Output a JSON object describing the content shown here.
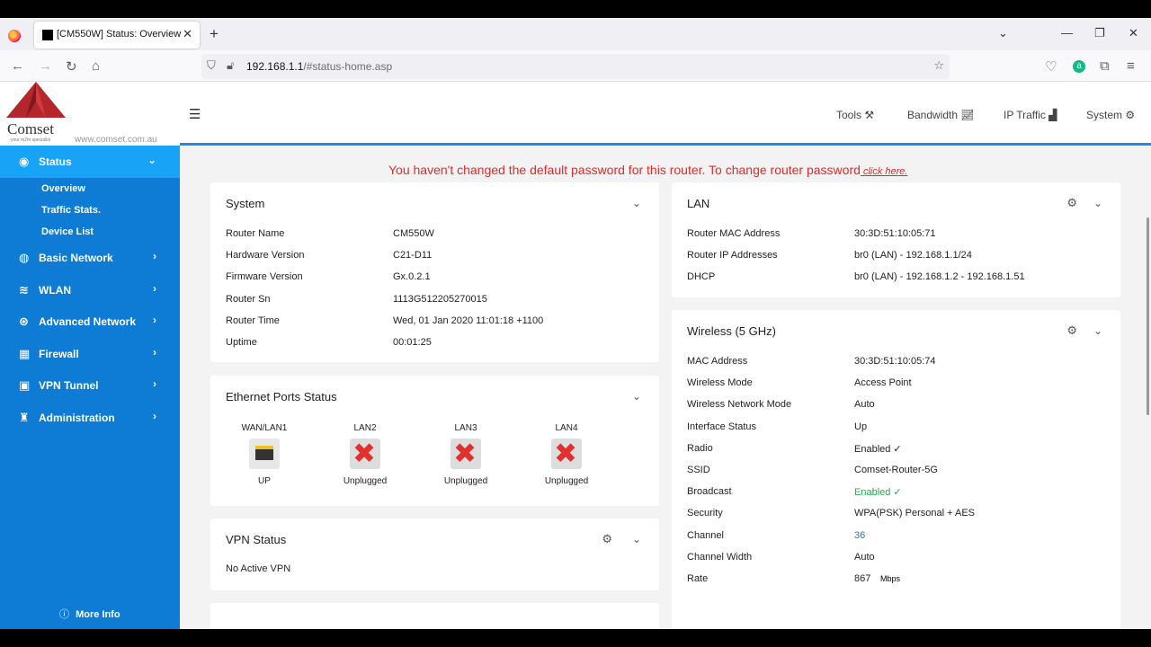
{
  "browser": {
    "tab_title": "[CM550W] Status: Overview",
    "url_host": "192.168.1.1",
    "url_path": "/#status-home.asp"
  },
  "brand": {
    "name": "Comset",
    "tagline": "your m2m specialist",
    "website": "www.comset.com.au",
    "logo_color": "#b3262b"
  },
  "topnav": {
    "tools": "Tools",
    "bandwidth": "Bandwidth",
    "ip_traffic": "IP Traffic",
    "system": "System"
  },
  "sidebar": {
    "status": "Status",
    "sub": [
      "Overview",
      "Traffic Stats.",
      "Device List"
    ],
    "items": [
      "Basic Network",
      "WLAN",
      "Advanced Network",
      "Firewall",
      "VPN Tunnel",
      "Administration"
    ],
    "more_info": "More Info"
  },
  "warning": {
    "text": "You haven't changed the default password for this router. To change router password",
    "link": " click here."
  },
  "system": {
    "title": "System",
    "rows": [
      {
        "label": "Router Name",
        "value": "CM550W"
      },
      {
        "label": "Hardware Version",
        "value": "C21-D11"
      },
      {
        "label": "Firmware Version",
        "value": "Gx.0.2.1"
      },
      {
        "label": "Router Sn",
        "value": "1113G512205270015"
      },
      {
        "label": "Router Time",
        "value": "Wed, 01 Jan 2020 11:01:18 +1100"
      },
      {
        "label": "Uptime",
        "value": "00:01:25"
      }
    ]
  },
  "ethernet": {
    "title": "Ethernet Ports Status",
    "ports": [
      {
        "name": "WAN/LAN1",
        "status": "UP"
      },
      {
        "name": "LAN2",
        "status": "Unplugged"
      },
      {
        "name": "LAN3",
        "status": "Unplugged"
      },
      {
        "name": "LAN4",
        "status": "Unplugged"
      }
    ]
  },
  "vpn": {
    "title": "VPN Status",
    "text": "No Active VPN"
  },
  "lan": {
    "title": "LAN",
    "rows": [
      {
        "label": "Router MAC Address",
        "value": "30:3D:51:10:05:71"
      },
      {
        "label": "Router IP Addresses",
        "value": "br0 (LAN) - 192.168.1.1/24"
      },
      {
        "label": "DHCP",
        "value": "br0 (LAN) - 192.168.1.2 - 192.168.1.51"
      }
    ]
  },
  "wireless": {
    "title": "Wireless (5 GHz)",
    "rows": [
      {
        "label": "MAC Address",
        "value": "30:3D:51:10:05:74"
      },
      {
        "label": "Wireless Mode",
        "value": "Access Point"
      },
      {
        "label": "Wireless Network Mode",
        "value": "Auto"
      },
      {
        "label": "Interface Status",
        "value": "Up"
      },
      {
        "label": "Radio",
        "value": "Enabled ✓"
      },
      {
        "label": "SSID",
        "value": "Comset-Router-5G"
      },
      {
        "label": "Broadcast",
        "value": "Enabled ✓"
      },
      {
        "label": "Security",
        "value": "WPA(PSK) Personal + AES"
      },
      {
        "label": "Channel",
        "value": "36"
      },
      {
        "label": "Channel Width",
        "value": "Auto"
      },
      {
        "label": "Rate",
        "value": "867"
      }
    ],
    "rate_unit": "Mbps"
  }
}
